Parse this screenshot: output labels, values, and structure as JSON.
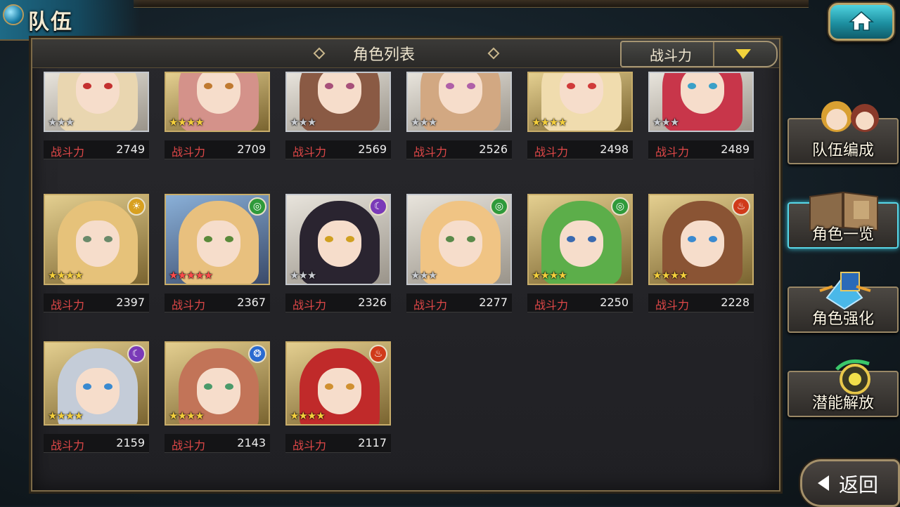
{
  "header": {
    "title": "队伍",
    "home_icon": "home-icon"
  },
  "panel": {
    "title": "角色列表",
    "sort": {
      "selected": "战斗力"
    }
  },
  "power_label": "战斗力",
  "characters": [
    {
      "power": "2749",
      "stars": "★★★",
      "rarity": "silver",
      "element": "",
      "hair": "#e9d6b0",
      "eyes": "#c43030"
    },
    {
      "power": "2709",
      "stars": "★★★★",
      "rarity": "gold",
      "element": "",
      "hair": "#d4928a",
      "eyes": "#c07a30"
    },
    {
      "power": "2569",
      "stars": "★★★",
      "rarity": "silver",
      "element": "",
      "hair": "#8a5a44",
      "eyes": "#a8507a"
    },
    {
      "power": "2526",
      "stars": "★★★",
      "rarity": "silver",
      "element": "",
      "hair": "#d2a882",
      "eyes": "#b060a8"
    },
    {
      "power": "2498",
      "stars": "★★★★",
      "rarity": "gold",
      "element": "",
      "hair": "#f0dcae",
      "eyes": "#d03a3a"
    },
    {
      "power": "2489",
      "stars": "★★★",
      "rarity": "silver",
      "element": "",
      "hair": "#c8364a",
      "eyes": "#3aa0c8"
    },
    {
      "power": "2397",
      "stars": "★★★★",
      "rarity": "gold",
      "element": "light",
      "hair": "#e6c27a",
      "eyes": "#6a8a6a"
    },
    {
      "power": "2367",
      "stars": "★★★★★",
      "rarity": "red",
      "element": "wind",
      "hair": "#e8c07e",
      "eyes": "#5a8a3a"
    },
    {
      "power": "2326",
      "stars": "★★★",
      "rarity": "silver",
      "element": "dark",
      "hair": "#2a2430",
      "eyes": "#d0a020"
    },
    {
      "power": "2277",
      "stars": "★★★",
      "rarity": "silver",
      "element": "wind",
      "hair": "#f0c484",
      "eyes": "#5a8a4a"
    },
    {
      "power": "2250",
      "stars": "★★★★",
      "rarity": "gold",
      "element": "wind",
      "hair": "#5cae4a",
      "eyes": "#3a6ab0"
    },
    {
      "power": "2228",
      "stars": "★★★★",
      "rarity": "gold",
      "element": "fire",
      "hair": "#8a5434",
      "eyes": "#3a8ad0"
    },
    {
      "power": "2159",
      "stars": "★★★★",
      "rarity": "gold",
      "element": "dark",
      "hair": "#c4ccd8",
      "eyes": "#3a8ad0"
    },
    {
      "power": "2143",
      "stars": "★★★★",
      "rarity": "gold",
      "element": "water",
      "hair": "#c27458",
      "eyes": "#4a9a6a"
    },
    {
      "power": "2117",
      "stars": "★★★★",
      "rarity": "gold",
      "element": "fire",
      "hair": "#c02a2a",
      "eyes": "#d09030"
    }
  ],
  "element_colors": {
    "light": "#d8a020",
    "wind": "#2f9a3a",
    "dark": "#7a3ab8",
    "fire": "#d03a1a",
    "water": "#2a6ad0"
  },
  "side_menu": [
    {
      "label": "队伍编成",
      "icon": "team-characters-icon",
      "active": false
    },
    {
      "label": "角色一览",
      "icon": "book-icon",
      "active": true
    },
    {
      "label": "角色强化",
      "icon": "enhance-crystal-icon",
      "active": false
    },
    {
      "label": "潜能解放",
      "icon": "potential-orb-icon",
      "active": false
    }
  ],
  "back_button": {
    "label": "返回"
  }
}
